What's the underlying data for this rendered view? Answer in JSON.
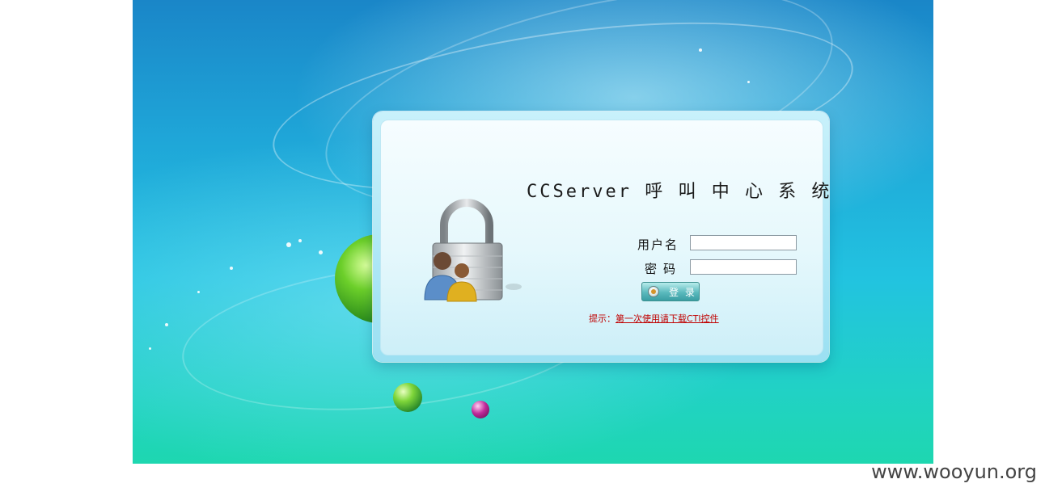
{
  "app": {
    "title": "CCServer 呼 叫 中 心 系 统"
  },
  "form": {
    "username_label": "用户名",
    "username_value": "",
    "password_label": "密码",
    "password_value": "",
    "login_button_label": "登 录"
  },
  "hint": {
    "prefix": "提示：",
    "link_text": "第一次使用请下载CTI控件"
  },
  "watermark": {
    "text": "www.wooyun.org"
  },
  "icons": {
    "lock": "padlock-users-icon",
    "login": "login-icon"
  },
  "colors": {
    "hint_text": "#c00000",
    "button": "#4aaeb3"
  }
}
